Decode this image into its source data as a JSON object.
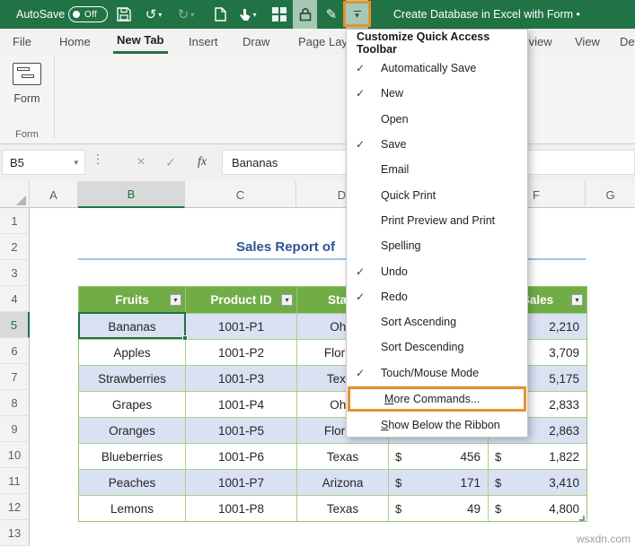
{
  "titlebar": {
    "autosave_label": "AutoSave",
    "autosave_state": "Off",
    "title": "Create Database in Excel with Form •"
  },
  "tabs": {
    "file": "File",
    "home": "Home",
    "new_tab": "New Tab",
    "insert": "Insert",
    "draw": "Draw",
    "page_layout": "Page Layout",
    "review": "Review",
    "view": "View",
    "developer": "Developer"
  },
  "ribbon": {
    "form_button_label": "Form",
    "form_group_label": "Form"
  },
  "formula_bar": {
    "name_box": "B5",
    "formula": "Bananas",
    "fx_label": "fx"
  },
  "qat_menu": {
    "header": "Customize Quick Access Toolbar",
    "items": [
      {
        "label": "Automatically Save",
        "check": "✓"
      },
      {
        "label": "New",
        "check": "✓"
      },
      {
        "label": "Open",
        "check": ""
      },
      {
        "label": "Save",
        "check": "✓"
      },
      {
        "label": "Email",
        "check": ""
      },
      {
        "label": "Quick Print",
        "check": ""
      },
      {
        "label": "Print Preview and Print",
        "check": ""
      },
      {
        "label": "Spelling",
        "check": ""
      },
      {
        "label": "Undo",
        "check": "✓"
      },
      {
        "label": "Redo",
        "check": "✓"
      },
      {
        "label": "Sort Ascending",
        "check": ""
      },
      {
        "label": "Sort Descending",
        "check": ""
      },
      {
        "label": "Touch/Mouse Mode",
        "check": "✓"
      }
    ],
    "footer_items": [
      {
        "ak": "M",
        "rest": "ore Commands...",
        "highlighted": true
      },
      {
        "ak": "S",
        "rest": "how Below the Ribbon",
        "highlighted": false
      }
    ]
  },
  "sheet": {
    "selected_cell": "B5",
    "column_headers": [
      "A",
      "B",
      "C",
      "D",
      "E",
      "F",
      "G"
    ],
    "row_headers": [
      "1",
      "2",
      "3",
      "4",
      "5",
      "6",
      "7",
      "8",
      "9",
      "10",
      "11",
      "12",
      "13"
    ],
    "title": "Sales Report of",
    "table": {
      "currency": "$",
      "headers": [
        "Fruits",
        "Product ID",
        "State",
        "",
        "Sales"
      ],
      "rows": [
        [
          "Bananas",
          "1001-P1",
          "Ohio",
          "",
          "2,210"
        ],
        [
          "Apples",
          "1001-P2",
          "Florida",
          "",
          "3,709"
        ],
        [
          "Strawberries",
          "1001-P3",
          "Texas",
          "",
          "5,175"
        ],
        [
          "Grapes",
          "1001-P4",
          "Ohio",
          "",
          "2,833"
        ],
        [
          "Oranges",
          "1001-P5",
          "Florida",
          "",
          "2,863"
        ],
        [
          "Blueberries",
          "1001-P6",
          "Texas",
          "456",
          "1,822"
        ],
        [
          "Peaches",
          "1001-P7",
          "Arizona",
          "171",
          "3,410"
        ],
        [
          "Lemons",
          "1001-P8",
          "Texas",
          "49",
          "4,800"
        ]
      ]
    }
  },
  "icons": {
    "check": "✓",
    "caret_down": "▾",
    "undo": "↺",
    "redo": "↻",
    "pen": "✎",
    "close": "×",
    "dots": "⋮"
  },
  "colors": {
    "excel_green": "#217346",
    "highlight_orange": "#E8912D",
    "table_header_green": "#70AD47",
    "band_blue": "#D9E1F2",
    "title_blue": "#2E5597",
    "underline_blue": "#9DC3E6"
  },
  "watermark": "wsxdn.com"
}
